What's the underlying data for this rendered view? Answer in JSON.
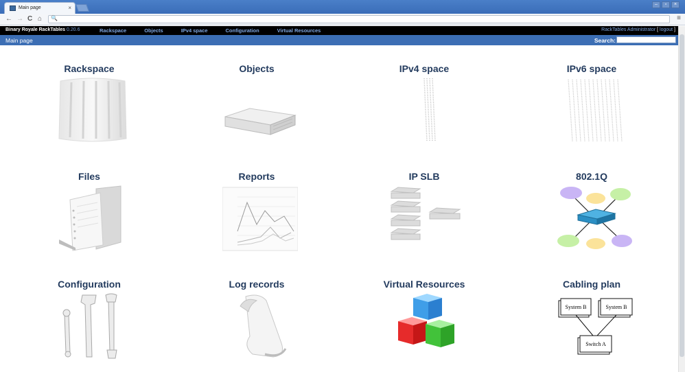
{
  "browser": {
    "tab_title": "Main page",
    "tab_close": "×",
    "omnibox_icon": "🔍",
    "nav": {
      "back": "←",
      "forward": "→",
      "reload": "C",
      "home": "⌂"
    },
    "menu": "≡",
    "window_buttons": [
      "–",
      "▫",
      "×"
    ]
  },
  "header": {
    "brand": "Binary Royale RackTables",
    "version": "0.20.6",
    "nav_items": [
      "Rackspace",
      "Objects",
      "IPv4 space",
      "Configuration",
      "Virtual Resources"
    ],
    "user_text": "RackTables Administrator",
    "logout": "logout"
  },
  "pathbar": {
    "title": "Main page",
    "search_label": "Search:",
    "search_value": ""
  },
  "pages": [
    {
      "label": "Rackspace",
      "icon": "rack-icon"
    },
    {
      "label": "Objects",
      "icon": "server-icon"
    },
    {
      "label": "IPv4 space",
      "icon": "ipv4-icon"
    },
    {
      "label": "IPv6 space",
      "icon": "ipv6-icon"
    },
    {
      "label": "Files",
      "icon": "folder-icon"
    },
    {
      "label": "Reports",
      "icon": "report-chart-icon"
    },
    {
      "label": "IP SLB",
      "icon": "slb-icon"
    },
    {
      "label": "802.1Q",
      "icon": "vlan-icon"
    },
    {
      "label": "Configuration",
      "icon": "wrench-icon"
    },
    {
      "label": "Log records",
      "icon": "scroll-icon"
    },
    {
      "label": "Virtual Resources",
      "icon": "cubes-icon"
    },
    {
      "label": "Cabling plan",
      "icon": "cabling-icon"
    }
  ],
  "cabling": {
    "box1": "System B",
    "box2": "System B",
    "box3": "Switch A"
  },
  "colors": {
    "header_bg": "#000000",
    "pathbar_bg": "#3c6eb4",
    "link": "#7ea6e0",
    "title": "#233b5e"
  }
}
